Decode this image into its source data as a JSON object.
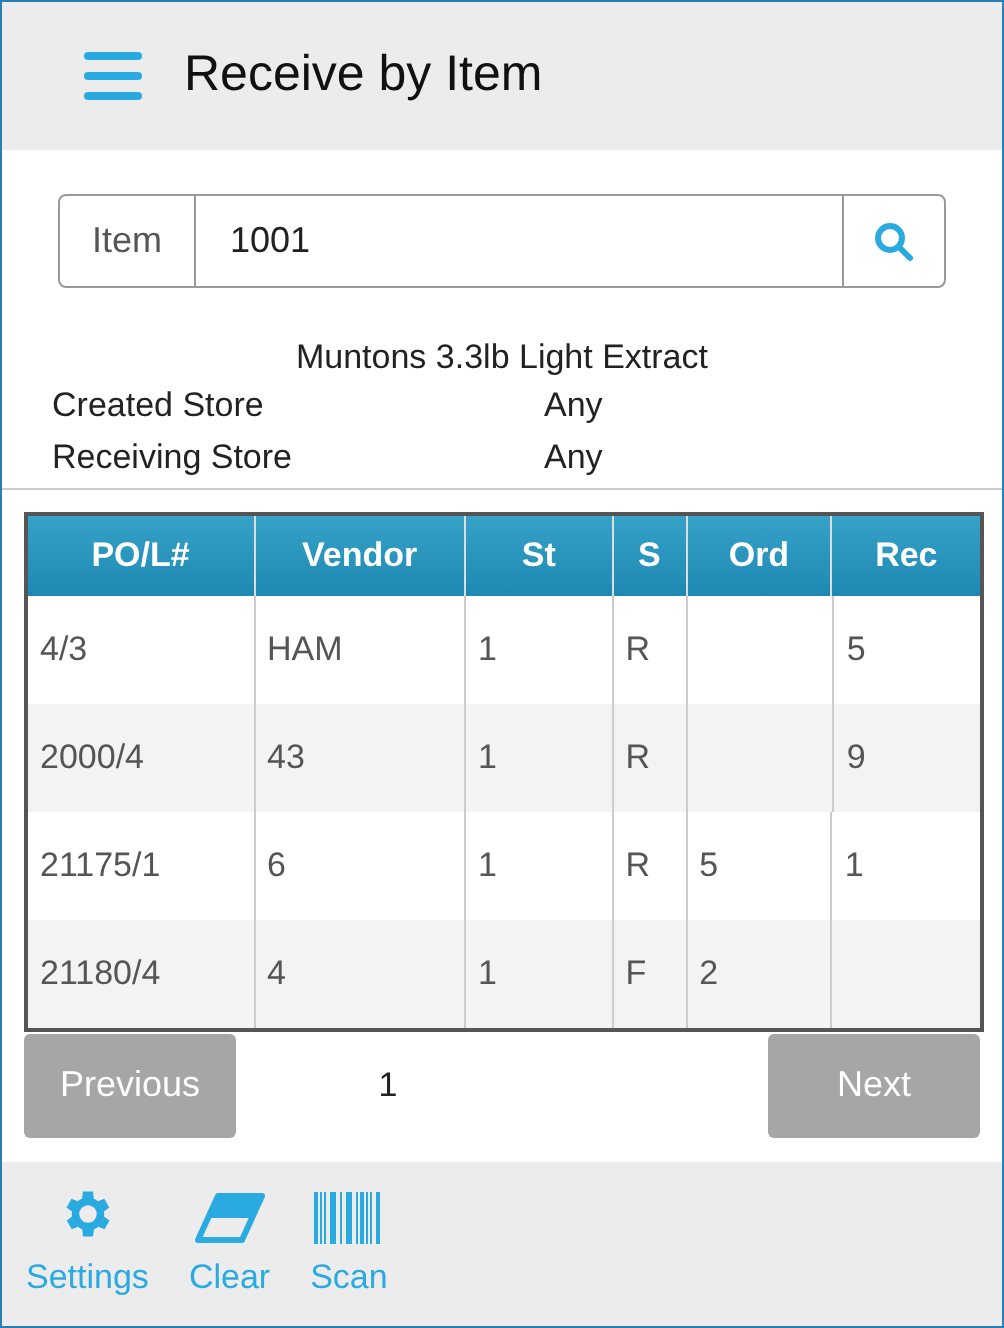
{
  "header": {
    "title": "Receive by Item"
  },
  "search": {
    "label": "Item",
    "value": "1001"
  },
  "item_description": "Muntons 3.3lb Light Extract",
  "details": [
    {
      "label": "Created Store",
      "value": "Any"
    },
    {
      "label": "Receiving Store",
      "value": "Any"
    }
  ],
  "table": {
    "columns": [
      "PO/L#",
      "Vendor",
      "St",
      "S",
      "Ord",
      "Rec"
    ],
    "rows": [
      [
        "4/3",
        "HAM",
        "1",
        "R",
        "",
        "5"
      ],
      [
        "2000/4",
        "43",
        "1",
        "R",
        "",
        "9"
      ],
      [
        "21175/1",
        "6",
        "1",
        "R",
        "5",
        "1"
      ],
      [
        "21180/4",
        "4",
        "1",
        "F",
        "2",
        ""
      ]
    ]
  },
  "pagination": {
    "previous": "Previous",
    "page": "1",
    "next": "Next"
  },
  "toolbar": [
    {
      "kind": "settings",
      "label": "Settings"
    },
    {
      "kind": "clear",
      "label": "Clear"
    },
    {
      "kind": "scan",
      "label": "Scan"
    }
  ]
}
